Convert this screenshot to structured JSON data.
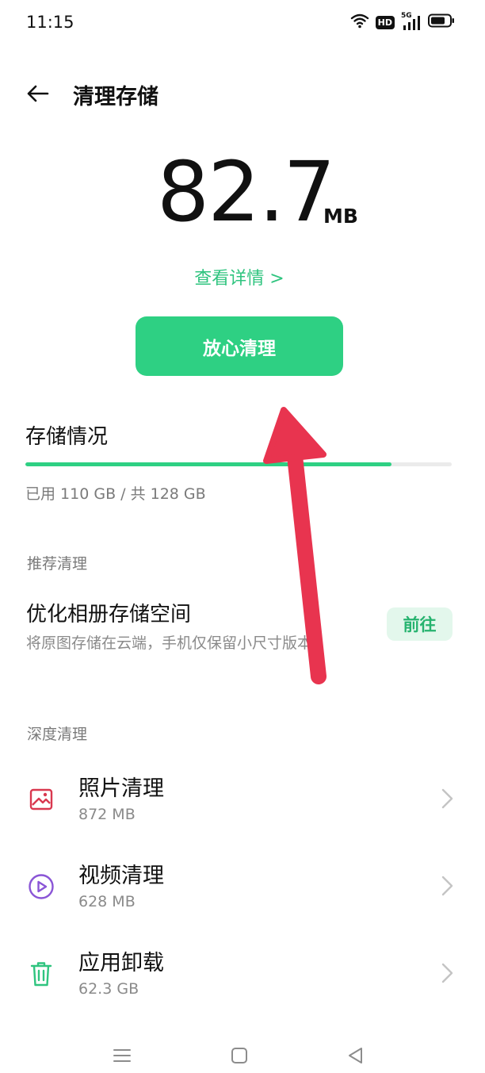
{
  "status_bar": {
    "time": "11:15",
    "hd_label": "HD",
    "network_label": "5G",
    "icons": [
      "wifi-icon",
      "hd-icon",
      "signal-5g-icon",
      "battery-icon"
    ]
  },
  "header": {
    "title": "清理存储",
    "back_icon": "arrow-left-icon"
  },
  "cleanable": {
    "value": "82.7",
    "unit": "MB"
  },
  "details_link": "查看详情 >",
  "clean_button_label": "放心清理",
  "storage": {
    "title": "存储情况",
    "summary": "已用 110 GB / 共 128 GB",
    "used_fraction": 0.859,
    "bar_color": "#2ed083"
  },
  "recommended": {
    "section_label": "推荐清理",
    "item": {
      "title": "优化相册存储空间",
      "subtitle": "将原图存储在云端，手机仅保留小尺寸版本",
      "button_label": "前往"
    }
  },
  "deep_clean": {
    "section_label": "深度清理",
    "items": [
      {
        "title": "照片清理",
        "size": "872 MB",
        "icon": "photo-icon",
        "color": "#d9384f"
      },
      {
        "title": "视频清理",
        "size": "628 MB",
        "icon": "video-play-icon",
        "color": "#8a55d6"
      },
      {
        "title": "应用卸载",
        "size": "62.3 GB",
        "icon": "trash-icon",
        "color": "#2fc47f"
      }
    ]
  },
  "nav": {
    "icons": [
      "menu-icon",
      "home-square-icon",
      "back-triangle-icon"
    ]
  },
  "colors": {
    "accent": "#2ed083",
    "annotation_arrow": "#e8344f"
  }
}
